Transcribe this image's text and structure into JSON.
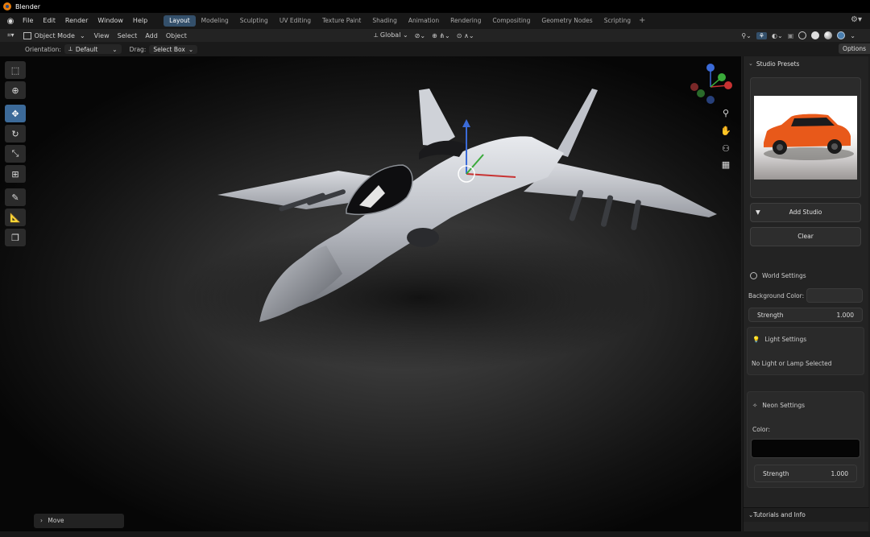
{
  "titlebar": {
    "title": "Blender"
  },
  "menubar": {
    "menus": [
      "File",
      "Edit",
      "Render",
      "Window",
      "Help"
    ],
    "workspaces": [
      "Layout",
      "Modeling",
      "Sculpting",
      "UV Editing",
      "Texture Paint",
      "Shading",
      "Animation",
      "Rendering",
      "Compositing",
      "Geometry Nodes",
      "Scripting"
    ],
    "active_workspace": "Layout",
    "add_workspace": "+"
  },
  "header": {
    "mode": "Object Mode",
    "view": "View",
    "select": "Select",
    "add": "Add",
    "object": "Object",
    "transform_orientation": "Global"
  },
  "tool_settings": {
    "orientation_label": "Orientation:",
    "orientation_value": "Default",
    "drag_label": "Drag:",
    "drag_value": "Select Box",
    "options_button": "Options"
  },
  "operator_panel": {
    "label": "Move"
  },
  "npanel": {
    "studio_presets": {
      "title": "Studio Presets",
      "add_button": "Add Studio",
      "clear_button": "Clear"
    },
    "world_settings": {
      "title": "World Settings",
      "background_label": "Background Color:",
      "strength_label": "Strength",
      "strength_value": "1.000",
      "background_color": "#2e2e2e"
    },
    "light_settings": {
      "title": "Light Settings",
      "message": "No Light or Lamp Selected"
    },
    "neon_settings": {
      "title": "Neon Settings",
      "color_label": "Color:",
      "color_value": "#050505",
      "strength_label": "Strength",
      "strength_value": "1.000"
    },
    "tutorials": {
      "title": "Tutorials and Info"
    }
  },
  "colors": {
    "accent": "#34506b",
    "active_tool": "#3c6a99",
    "blender_orange": "#e87d0d",
    "car_orange": "#e8591a"
  },
  "icons": {
    "blender_logo": "blender-logo-icon",
    "gizmo": "navigation-gizmo-icon",
    "zoom": "zoom-icon",
    "pan": "hand-icon",
    "camera": "camera-icon",
    "grid": "grid-icon"
  }
}
